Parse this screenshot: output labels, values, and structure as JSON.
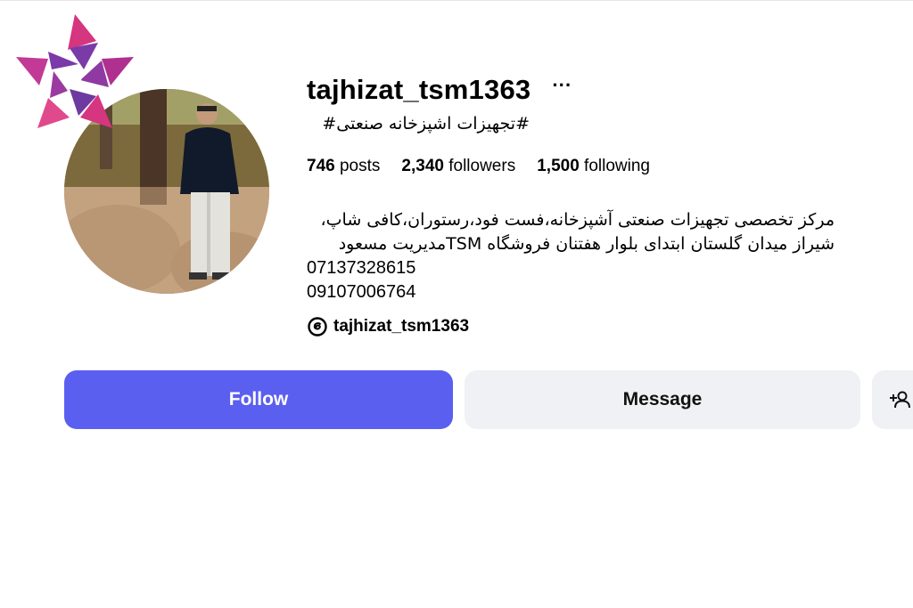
{
  "profile": {
    "username": "tajhizat_tsm1363",
    "more_label": "···",
    "category": "#تجهیزات اشپزخانه صنعتی#",
    "stats": {
      "posts_count": "746",
      "posts_label": "posts",
      "followers_count": "2,340",
      "followers_label": "followers",
      "following_count": "1,500",
      "following_label": "following"
    },
    "bio": {
      "line1": "مرکز تخصصی تجهیزات صنعتی آشپزخانه،فست فود،رستوران،کافی شاپ،",
      "line2": "شیراز میدان گلستان ابتدای بلوار هفتنان فروشگاه TSMمدیریت مسعود",
      "phone1": "07137328615",
      "phone2": "09107006764"
    },
    "threads_handle": "tajhizat_tsm1363",
    "avatar_icon": "profile-photo"
  },
  "actions": {
    "follow_label": "Follow",
    "message_label": "Message",
    "add_user_icon": "person-add-icon"
  },
  "colors": {
    "follow_bg": "#5b5ff0",
    "secondary_bg": "#f0f1f4",
    "watermark_pink": "#d6357f",
    "watermark_purple": "#7a3aa8"
  }
}
